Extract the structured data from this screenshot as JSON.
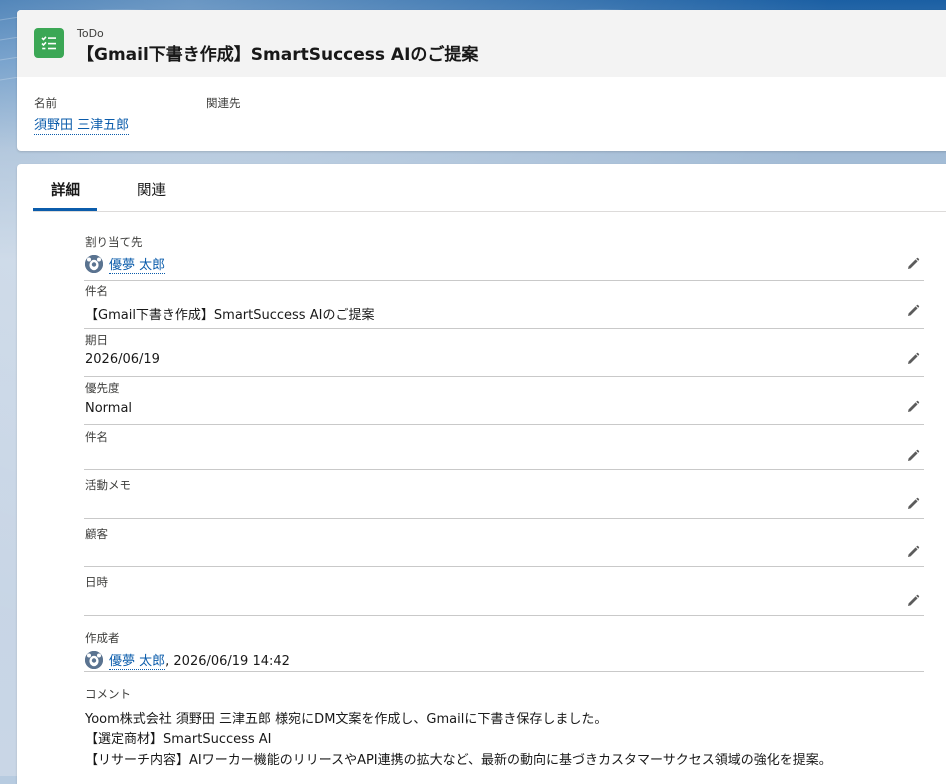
{
  "header": {
    "record_type": "ToDo",
    "title": "【Gmail下書き作成】SmartSuccess AIのご提案",
    "fields": {
      "name_label": "名前",
      "name_value": "須野田 三津五郎",
      "related_label": "関連先"
    }
  },
  "tabs": [
    {
      "label": "詳細",
      "active": true
    },
    {
      "label": "関連",
      "active": false
    }
  ],
  "details": {
    "assignee_label": "割り当て先",
    "assignee_value": "優夢 太郎",
    "subject_label": "件名",
    "subject_value": "【Gmail下書き作成】SmartSuccess AIのご提案",
    "due_label": "期日",
    "due_value": "2026/06/19",
    "priority_label": "優先度",
    "priority_value": "Normal",
    "subject2_label": "件名",
    "subject2_value": "",
    "activity_memo_label": "活動メモ",
    "activity_memo_value": "",
    "customer_label": "顧客",
    "customer_value": "",
    "datetime_label": "日時",
    "datetime_value": "",
    "created_by_label": "作成者",
    "created_by_name": "優夢 太郎",
    "created_by_date": ", 2026/06/19 14:42",
    "comment_label": "コメント",
    "comment_lines": [
      "Yoom株式会社 須野田 三津五郎 様宛にDM文案を作成し、Gmailに下書き保存しました。",
      "【選定商材】SmartSuccess AI",
      "【リサーチ内容】AIワーカー機能のリリースやAPI連携の拡大など、最新の動向に基づきカスタマーサクセス領域の強化を提案。"
    ]
  },
  "colors": {
    "accent": "#0b5cab",
    "record_icon": "#3ba755",
    "text": "#181818",
    "label": "#3e3e3c"
  },
  "icons": {
    "record": "todo-checklist-icon",
    "edit": "pencil-icon",
    "avatar": "user-avatar-icon"
  }
}
